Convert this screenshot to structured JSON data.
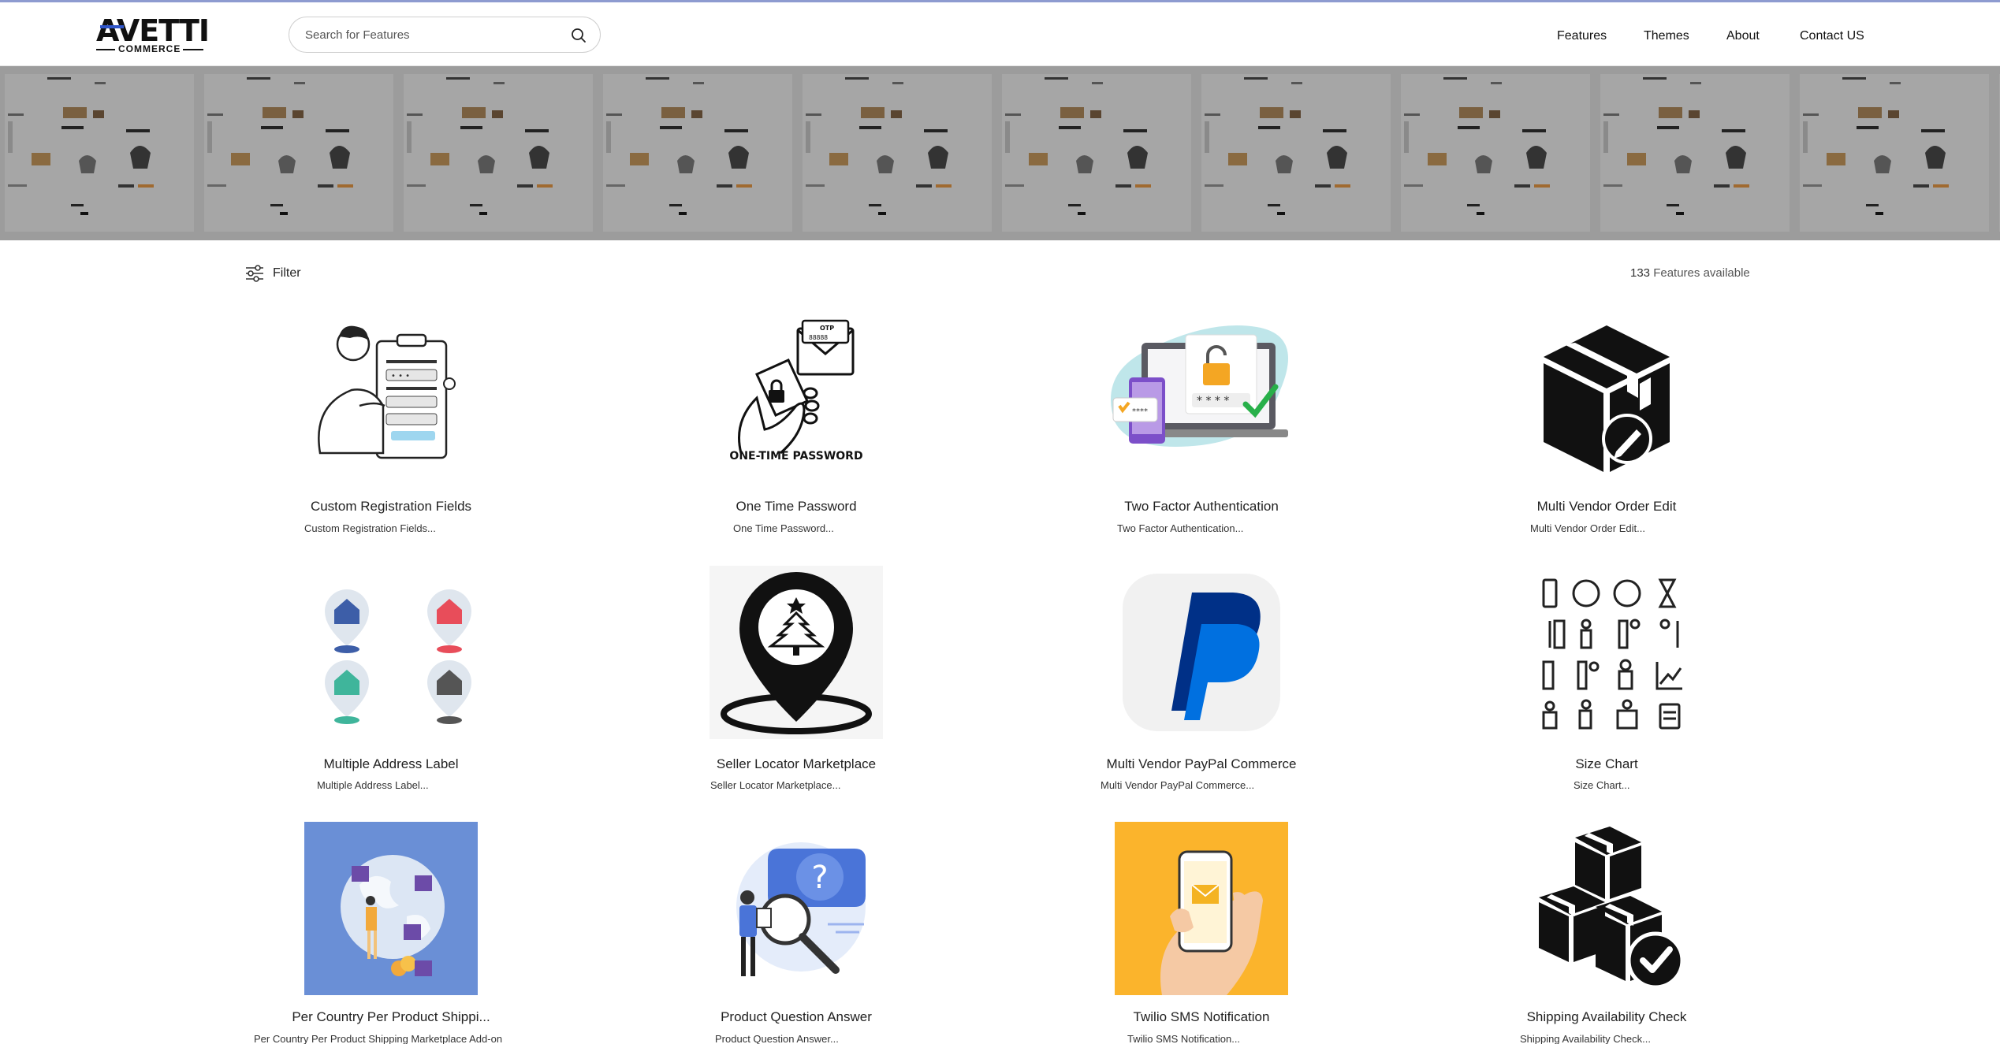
{
  "header": {
    "logo_main": "AVETTI",
    "logo_sub": "COMMERCE",
    "search_placeholder": "Search for Features",
    "nav": [
      {
        "label": "Features"
      },
      {
        "label": "Themes"
      },
      {
        "label": "About"
      },
      {
        "label": "Contact US"
      }
    ]
  },
  "toolbar": {
    "filter_label": "Filter",
    "count_number": "133",
    "count_label": "Features available"
  },
  "features": [
    {
      "title": "Custom Registration Fields",
      "subtitle": "Custom Registration Fields...",
      "icon": "registration-illustration"
    },
    {
      "title": "One Time Password",
      "subtitle": "One Time Password...",
      "icon": "otp-illustration",
      "image_text": "ONE-TIME PASSWORD"
    },
    {
      "title": "Two Factor Authentication",
      "subtitle": "Two Factor Authentication...",
      "icon": "two-factor-illustration"
    },
    {
      "title": "Multi Vendor Order Edit",
      "subtitle": "Multi Vendor Order Edit...",
      "icon": "box-edit-icon"
    },
    {
      "title": "Multiple Address Label",
      "subtitle": "Multiple Address Label...",
      "icon": "address-pins-icon"
    },
    {
      "title": "Seller Locator Marketplace",
      "subtitle": "Seller Locator Marketplace...",
      "icon": "location-pin-icon"
    },
    {
      "title": "Multi Vendor PayPal Commerce",
      "subtitle": "Multi Vendor PayPal Commerce...",
      "icon": "paypal-icon"
    },
    {
      "title": "Size Chart",
      "subtitle": "Size Chart...",
      "icon": "size-chart-icons"
    },
    {
      "title": "Per Country Per Product Shippi...",
      "subtitle": "Per Country Per Product Shipping Marketplace Add-on",
      "icon": "global-shipping-illustration"
    },
    {
      "title": "Product Question Answer",
      "subtitle": "Product Question Answer...",
      "icon": "question-illustration"
    },
    {
      "title": "Twilio SMS Notification",
      "subtitle": "Twilio SMS Notification...",
      "icon": "sms-phone-illustration"
    },
    {
      "title": "Shipping Availability Check",
      "subtitle": "Shipping Availability Check...",
      "icon": "boxes-check-icon"
    }
  ],
  "colors": {
    "brand_blue": "#2f55c9",
    "banner_gray": "#999999",
    "tile_blue": "#6a8fd6",
    "tile_yellow": "#fbb42c",
    "paypal_dark": "#003087",
    "paypal_light": "#0070e0"
  }
}
